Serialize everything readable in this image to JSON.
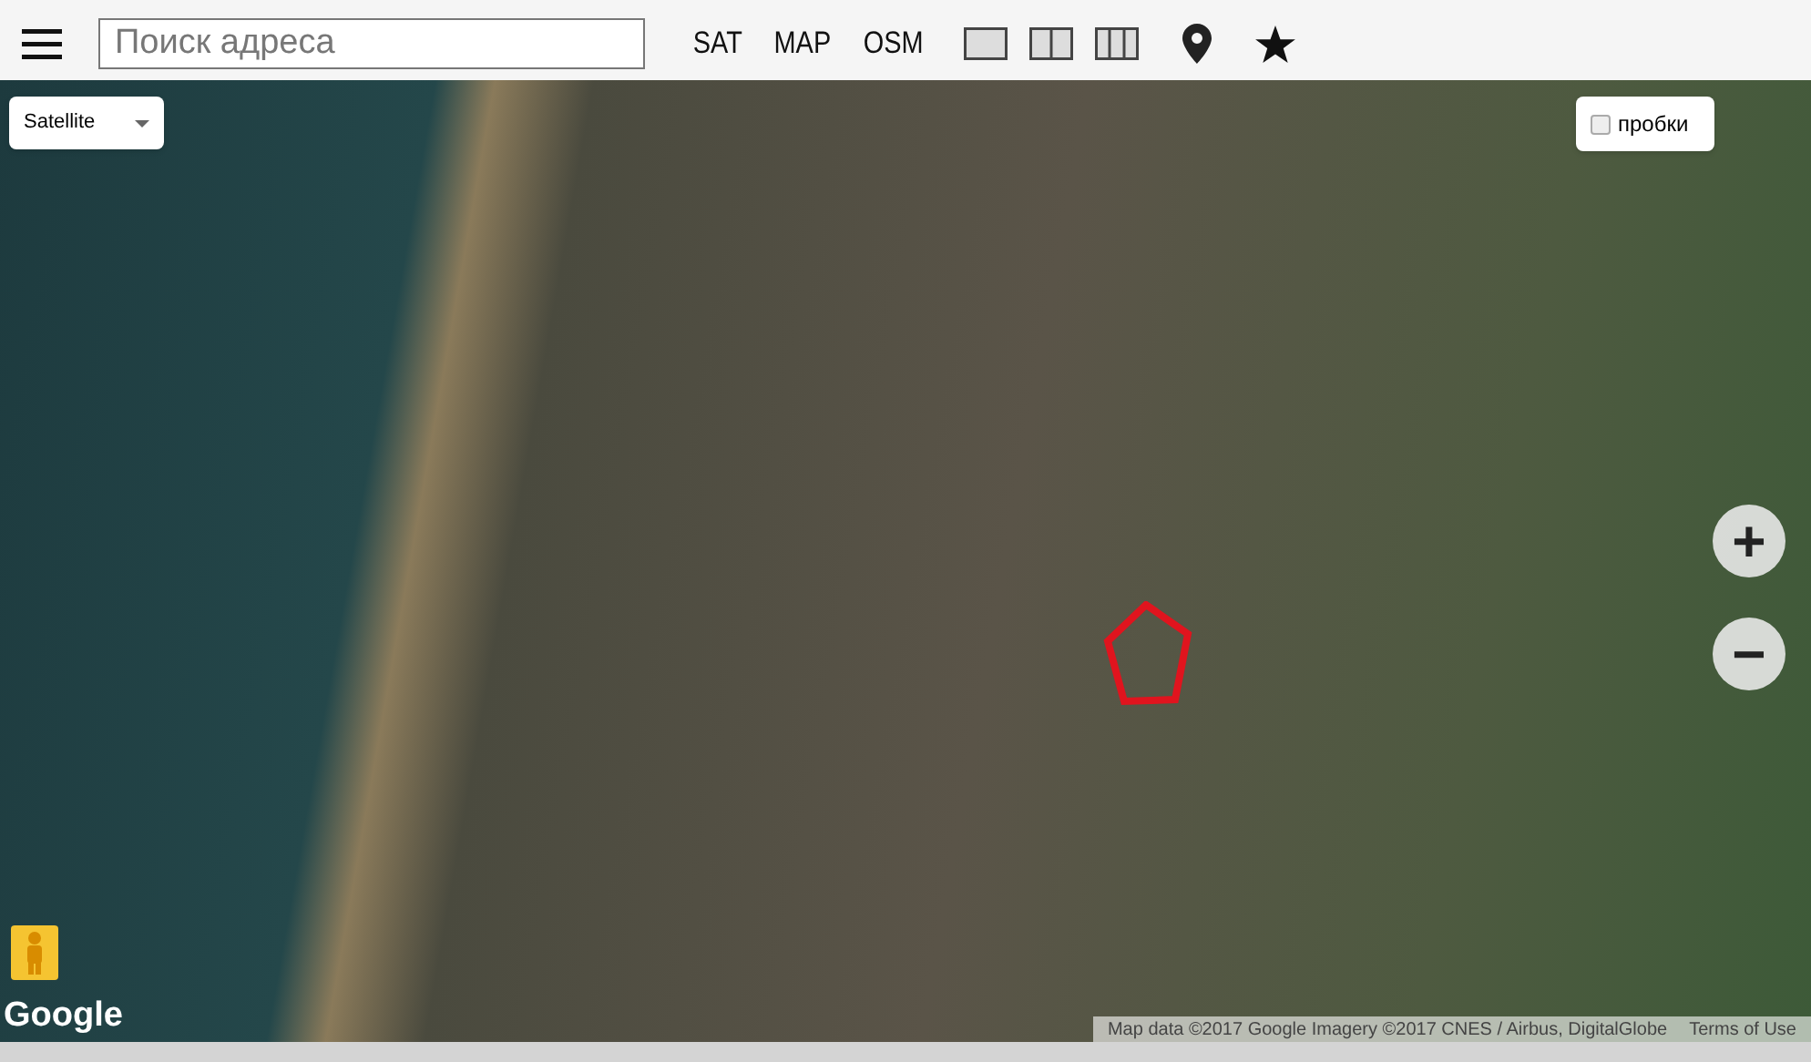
{
  "toolbar": {
    "search": {
      "placeholder": "Поиск адреса"
    },
    "layers": [
      {
        "label": "SAT"
      },
      {
        "label": "MAP"
      },
      {
        "label": "OSM"
      }
    ],
    "layouts": [
      {
        "kind": "single"
      },
      {
        "kind": "double"
      },
      {
        "kind": "triple"
      }
    ]
  },
  "map": {
    "map_type": {
      "value": "Satellite"
    },
    "traffic": {
      "label": "пробки",
      "checked": false
    },
    "zoom": [
      {
        "label": "+"
      },
      {
        "label": "−"
      }
    ],
    "logo": "Google",
    "attribution": "Map data ©2017 Google Imagery ©2017 CNES / Airbus, DigitalGlobe",
    "terms": "Terms of Use"
  }
}
